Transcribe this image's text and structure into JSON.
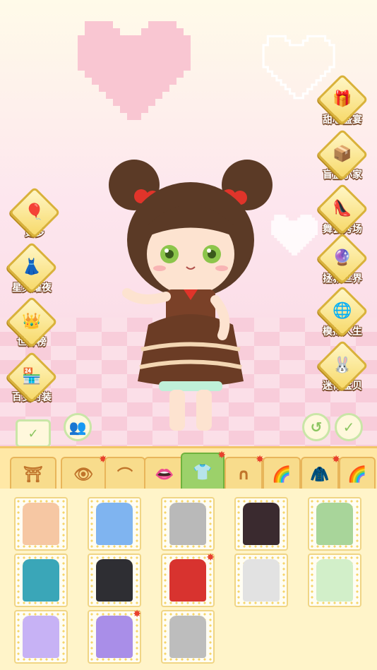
{
  "side_left": [
    {
      "label": "更多",
      "icon": "balloons-icon",
      "emoji": "🎈"
    },
    {
      "label": "星灵耀夜",
      "icon": "dress-icon",
      "emoji": "👗"
    },
    {
      "label": "世界榜",
      "icon": "crown-icon",
      "emoji": "👑"
    },
    {
      "label": "百变时装",
      "icon": "shop-icon",
      "emoji": "🏪"
    }
  ],
  "side_right": [
    {
      "label": "甜心盛宴",
      "icon": "cake-box-icon",
      "emoji": "🎁"
    },
    {
      "label": "盲盒小家",
      "icon": "blind-box-icon",
      "emoji": "📦"
    },
    {
      "label": "舞会秀场",
      "icon": "high-heel-icon",
      "emoji": "👠"
    },
    {
      "label": "拯救世界",
      "icon": "magic-circle-icon",
      "emoji": "🔮"
    },
    {
      "label": "模拟人生",
      "icon": "crystal-ball-icon",
      "emoji": "🌐"
    },
    {
      "label": "迷你宝贝",
      "icon": "bunny-icon",
      "emoji": "🐰"
    }
  ],
  "tabs": [
    {
      "icon": "background-tab-icon",
      "glyph": "⛩",
      "star": false,
      "active": false
    },
    {
      "icon": "eye-tab-icon",
      "glyph": "👁",
      "star": true,
      "active": false
    },
    {
      "icon": "eyebrow-tab-icon",
      "glyph": "⌒",
      "star": false,
      "active": false
    },
    {
      "icon": "lips-tab-icon",
      "glyph": "👄",
      "star": false,
      "active": false
    },
    {
      "icon": "outfit-tab-icon",
      "glyph": "👕",
      "star": true,
      "active": true
    },
    {
      "icon": "hair-tab-icon",
      "glyph": "∩",
      "star": true,
      "active": false
    },
    {
      "icon": "hair-color-tab-icon",
      "glyph": "🌈",
      "star": false,
      "active": false
    },
    {
      "icon": "coat-tab-icon",
      "glyph": "🧥",
      "star": true,
      "active": false
    },
    {
      "icon": "color-tab-icon",
      "glyph": "🌈",
      "star": false,
      "active": false
    }
  ],
  "outfits": [
    {
      "name": "outfit-peach-dress",
      "color": "#f6c7a3",
      "star": false
    },
    {
      "name": "outfit-blue-dress",
      "color": "#7fb4f0",
      "star": false
    },
    {
      "name": "outfit-gray-dress",
      "color": "#b9b9b9",
      "star": false
    },
    {
      "name": "outfit-black-red-dress",
      "color": "#3a2a2f",
      "star": false
    },
    {
      "name": "outfit-green-floral-dress",
      "color": "#a8d59a",
      "star": false
    },
    {
      "name": "outfit-teal-coat",
      "color": "#3aa6b8",
      "star": false
    },
    {
      "name": "outfit-black-coat",
      "color": "#2e2e33",
      "star": false
    },
    {
      "name": "outfit-red-coat",
      "color": "#d8332f",
      "star": true
    },
    {
      "name": "outfit-white-dress",
      "color": "#e2e2e2",
      "star": false
    },
    {
      "name": "outfit-mint-floral-dress",
      "color": "#d2efc9",
      "star": false
    },
    {
      "name": "outfit-lilac-gown",
      "color": "#c7b2f5",
      "star": false
    },
    {
      "name": "outfit-purple-dress",
      "color": "#a98ee8",
      "star": true
    },
    {
      "name": "outfit-gray-gown",
      "color": "#bdbdbd",
      "star": false
    }
  ]
}
